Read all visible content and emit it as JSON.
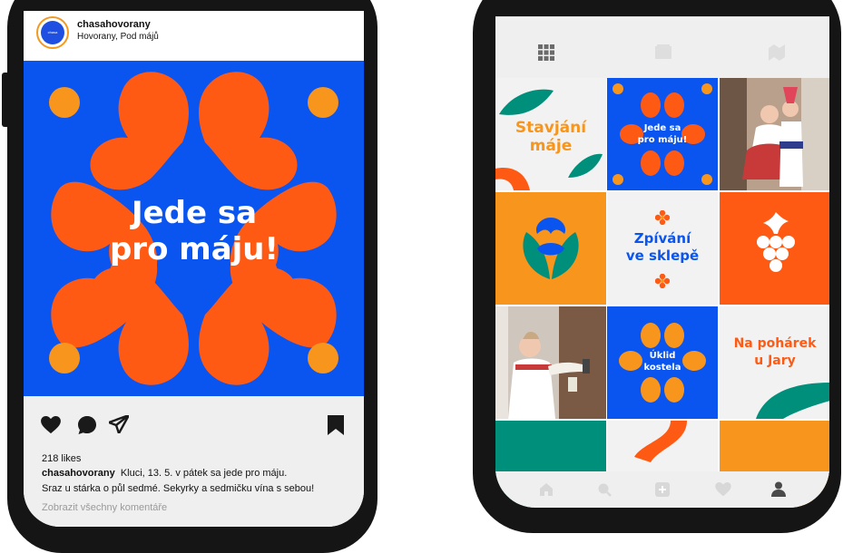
{
  "post": {
    "username": "chasahovorany",
    "location": "Hovorany, Pod májů",
    "avatar_text": "chasa hovorany",
    "title_line1": "Jede sa",
    "title_line2": "pro máju!",
    "likes": "218 likes",
    "caption_user": "chasahovorany",
    "caption_line1": "Kluci, 13. 5. v pátek sa jede pro máju.",
    "caption_line2": "Sraz u stárka o půl sedmé. Sekyrky a sedmičku vína s sebou!",
    "view_comments": "Zobrazit všechny komentáře"
  },
  "grid": {
    "tile_stavjani_line1": "Stavjání",
    "tile_stavjani_line2": "máje",
    "tile_jede_line1": "Jede sa",
    "tile_jede_line2": "pro máju!",
    "tile_zpivani_line1": "Zpívání",
    "tile_zpivani_line2": "ve sklepě",
    "tile_uklid_line1": "Úklid",
    "tile_uklid_line2": "kostela",
    "tile_poharek_line1": "Na pohárek",
    "tile_poharek_line2": "u Jary"
  },
  "colors": {
    "blue": "#0a55f0",
    "orange": "#ff5a14",
    "yellow": "#f7951d",
    "teal": "#008f7a",
    "light": "#f2f2f2"
  },
  "icons": {
    "like": "heart-icon",
    "comment": "comment-icon",
    "share": "send-icon",
    "save": "bookmark-icon",
    "grid": "grid-icon",
    "reels": "reels-icon",
    "tagged": "tagged-icon",
    "home": "home-icon",
    "search": "search-icon",
    "add": "add-icon",
    "activity": "heart-outline-icon",
    "profile": "profile-icon"
  }
}
